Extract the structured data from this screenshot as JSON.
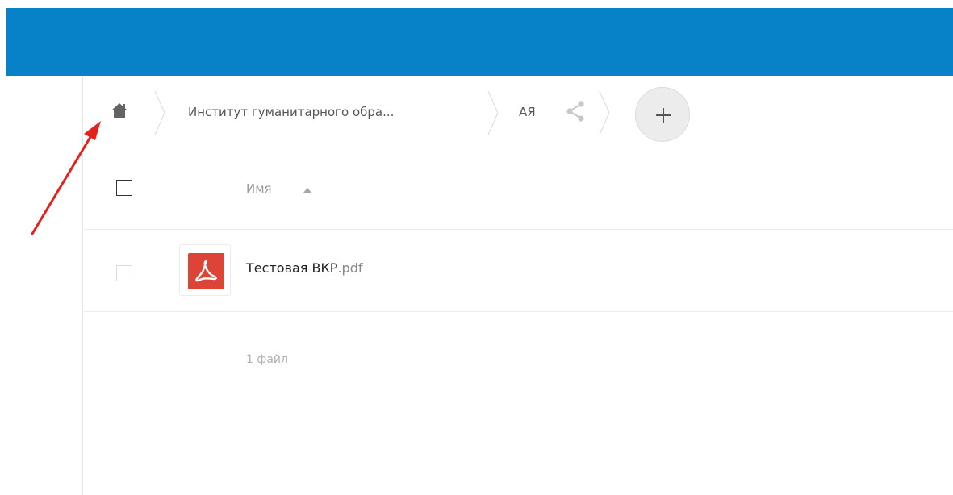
{
  "breadcrumb": {
    "items": [
      {
        "label": "Институт гуманитарного обра..."
      },
      {
        "label": "АЯ"
      }
    ]
  },
  "file_list": {
    "columns": {
      "name": "Имя"
    },
    "files": [
      {
        "basename": "Тестовая ВКР",
        "extension": ".pdf"
      }
    ],
    "summary": "1 файл"
  },
  "colors": {
    "topbar": "#0782c8",
    "pdf_icon": "#db4437",
    "annotation_arrow": "#e8201c"
  },
  "icons": [
    "home-icon",
    "share-icon",
    "plus-icon",
    "sort-ascending-icon",
    "pdf-file-icon"
  ]
}
